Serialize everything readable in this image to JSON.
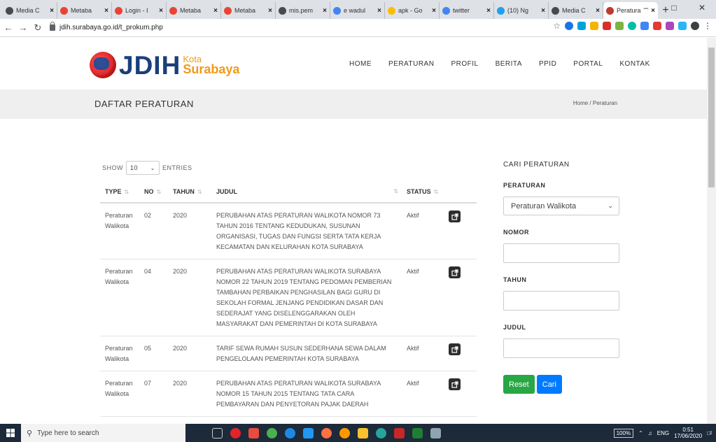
{
  "browser": {
    "tabs": [
      {
        "title": "Media C",
        "color": "#4a4a4a",
        "active": false
      },
      {
        "title": "Metaba",
        "color": "#ea4335",
        "active": false
      },
      {
        "title": "Login - I",
        "color": "#ea4335",
        "active": false
      },
      {
        "title": "Metaba",
        "color": "#ea4335",
        "active": false
      },
      {
        "title": "Metaba",
        "color": "#ea4335",
        "active": false
      },
      {
        "title": "mis.pem",
        "color": "#4a4a4a",
        "active": false
      },
      {
        "title": "e wadul",
        "color": "#4285f4",
        "active": false
      },
      {
        "title": "apk - Go",
        "color": "#fbbc05",
        "active": false
      },
      {
        "title": "twitter",
        "color": "#4285f4",
        "active": false
      },
      {
        "title": "(10) Ng",
        "color": "#1da1f2",
        "active": false
      },
      {
        "title": "Media C",
        "color": "#4a4a4a",
        "active": false
      },
      {
        "title": "Peratura",
        "color": "#c0392b",
        "active": true
      }
    ],
    "new_tab": "+",
    "url": "jdih.surabaya.go.id/t_prokum.php"
  },
  "site": {
    "logo_main": "JDIH",
    "logo_kota": "Kota",
    "logo_city": "Surabaya",
    "nav": [
      "HOME",
      "PERATURAN",
      "PROFIL",
      "BERITA",
      "PPID",
      "PORTAL",
      "KONTAK"
    ],
    "page_title": "DAFTAR PERATURAN",
    "breadcrumb": "Home  /  Peraturan"
  },
  "table": {
    "show_label": "SHOW",
    "entries_value": "10",
    "entries_label": "ENTRIES",
    "headers": {
      "type": "TYPE",
      "no": "NO",
      "tahun": "TAHUN",
      "judul": "JUDUL",
      "status": "STATUS"
    },
    "rows": [
      {
        "type": "Peraturan Walikota",
        "no": "02",
        "tahun": "2020",
        "judul": "PERUBAHAN ATAS PERATURAN WALIKOTA NOMOR 73 TAHUN 2016 TENTANG KEDUDUKAN, SUSUNAN ORGANISASI, TUGAS DAN FUNGSI SERTA TATA KERJA KECAMATAN DAN KELURAHAN KOTA SURABAYA",
        "status": "Aktif"
      },
      {
        "type": "Peraturan Walikota",
        "no": "04",
        "tahun": "2020",
        "judul": "PERUBAHAN ATAS PERATURAN WALIKOTA SURABAYA NOMOR 22 TAHUN 2019 TENTANG PEDOMAN PEMBERIAN TAMBAHAN PERBAIKAN PENGHASILAN BAGI GURU DI SEKOLAH FORMAL JENJANG PENDIDIKAN DASAR DAN SEDERAJAT YANG DISELENGGARAKAN OLEH MASYARAKAT DAN PEMERINTAH DI KOTA SURABAYA",
        "status": "Aktif"
      },
      {
        "type": "Peraturan Walikota",
        "no": "05",
        "tahun": "2020",
        "judul": "TARIF SEWA RUMAH SUSUN SEDERHANA SEWA DALAM PENGELOLAAN PEMERINTAH KOTA SURABAYA",
        "status": "Aktif"
      },
      {
        "type": "Peraturan Walikota",
        "no": "07",
        "tahun": "2020",
        "judul": "PERUBAHAN ATAS PERATURAN WALIKOTA SURABAYA NOMOR 15 TAHUN 2015 TENTANG TATA CARA PEMBAYARAN DAN PENYETORAN PAJAK DAERAH",
        "status": "Aktif"
      }
    ]
  },
  "search": {
    "heading": "CARI PERATURAN",
    "peraturan_label": "PERATURAN",
    "peraturan_value": "Peraturan Walikota",
    "nomor_label": "NOMOR",
    "tahun_label": "TAHUN",
    "judul_label": "JUDUL",
    "reset": "Reset",
    "cari": "Cari"
  },
  "taskbar": {
    "search_placeholder": "Type here to search",
    "zoom": "100%",
    "lang": "ENG",
    "time": "0:51",
    "date": "17/06/2020",
    "notif_count": "2"
  }
}
